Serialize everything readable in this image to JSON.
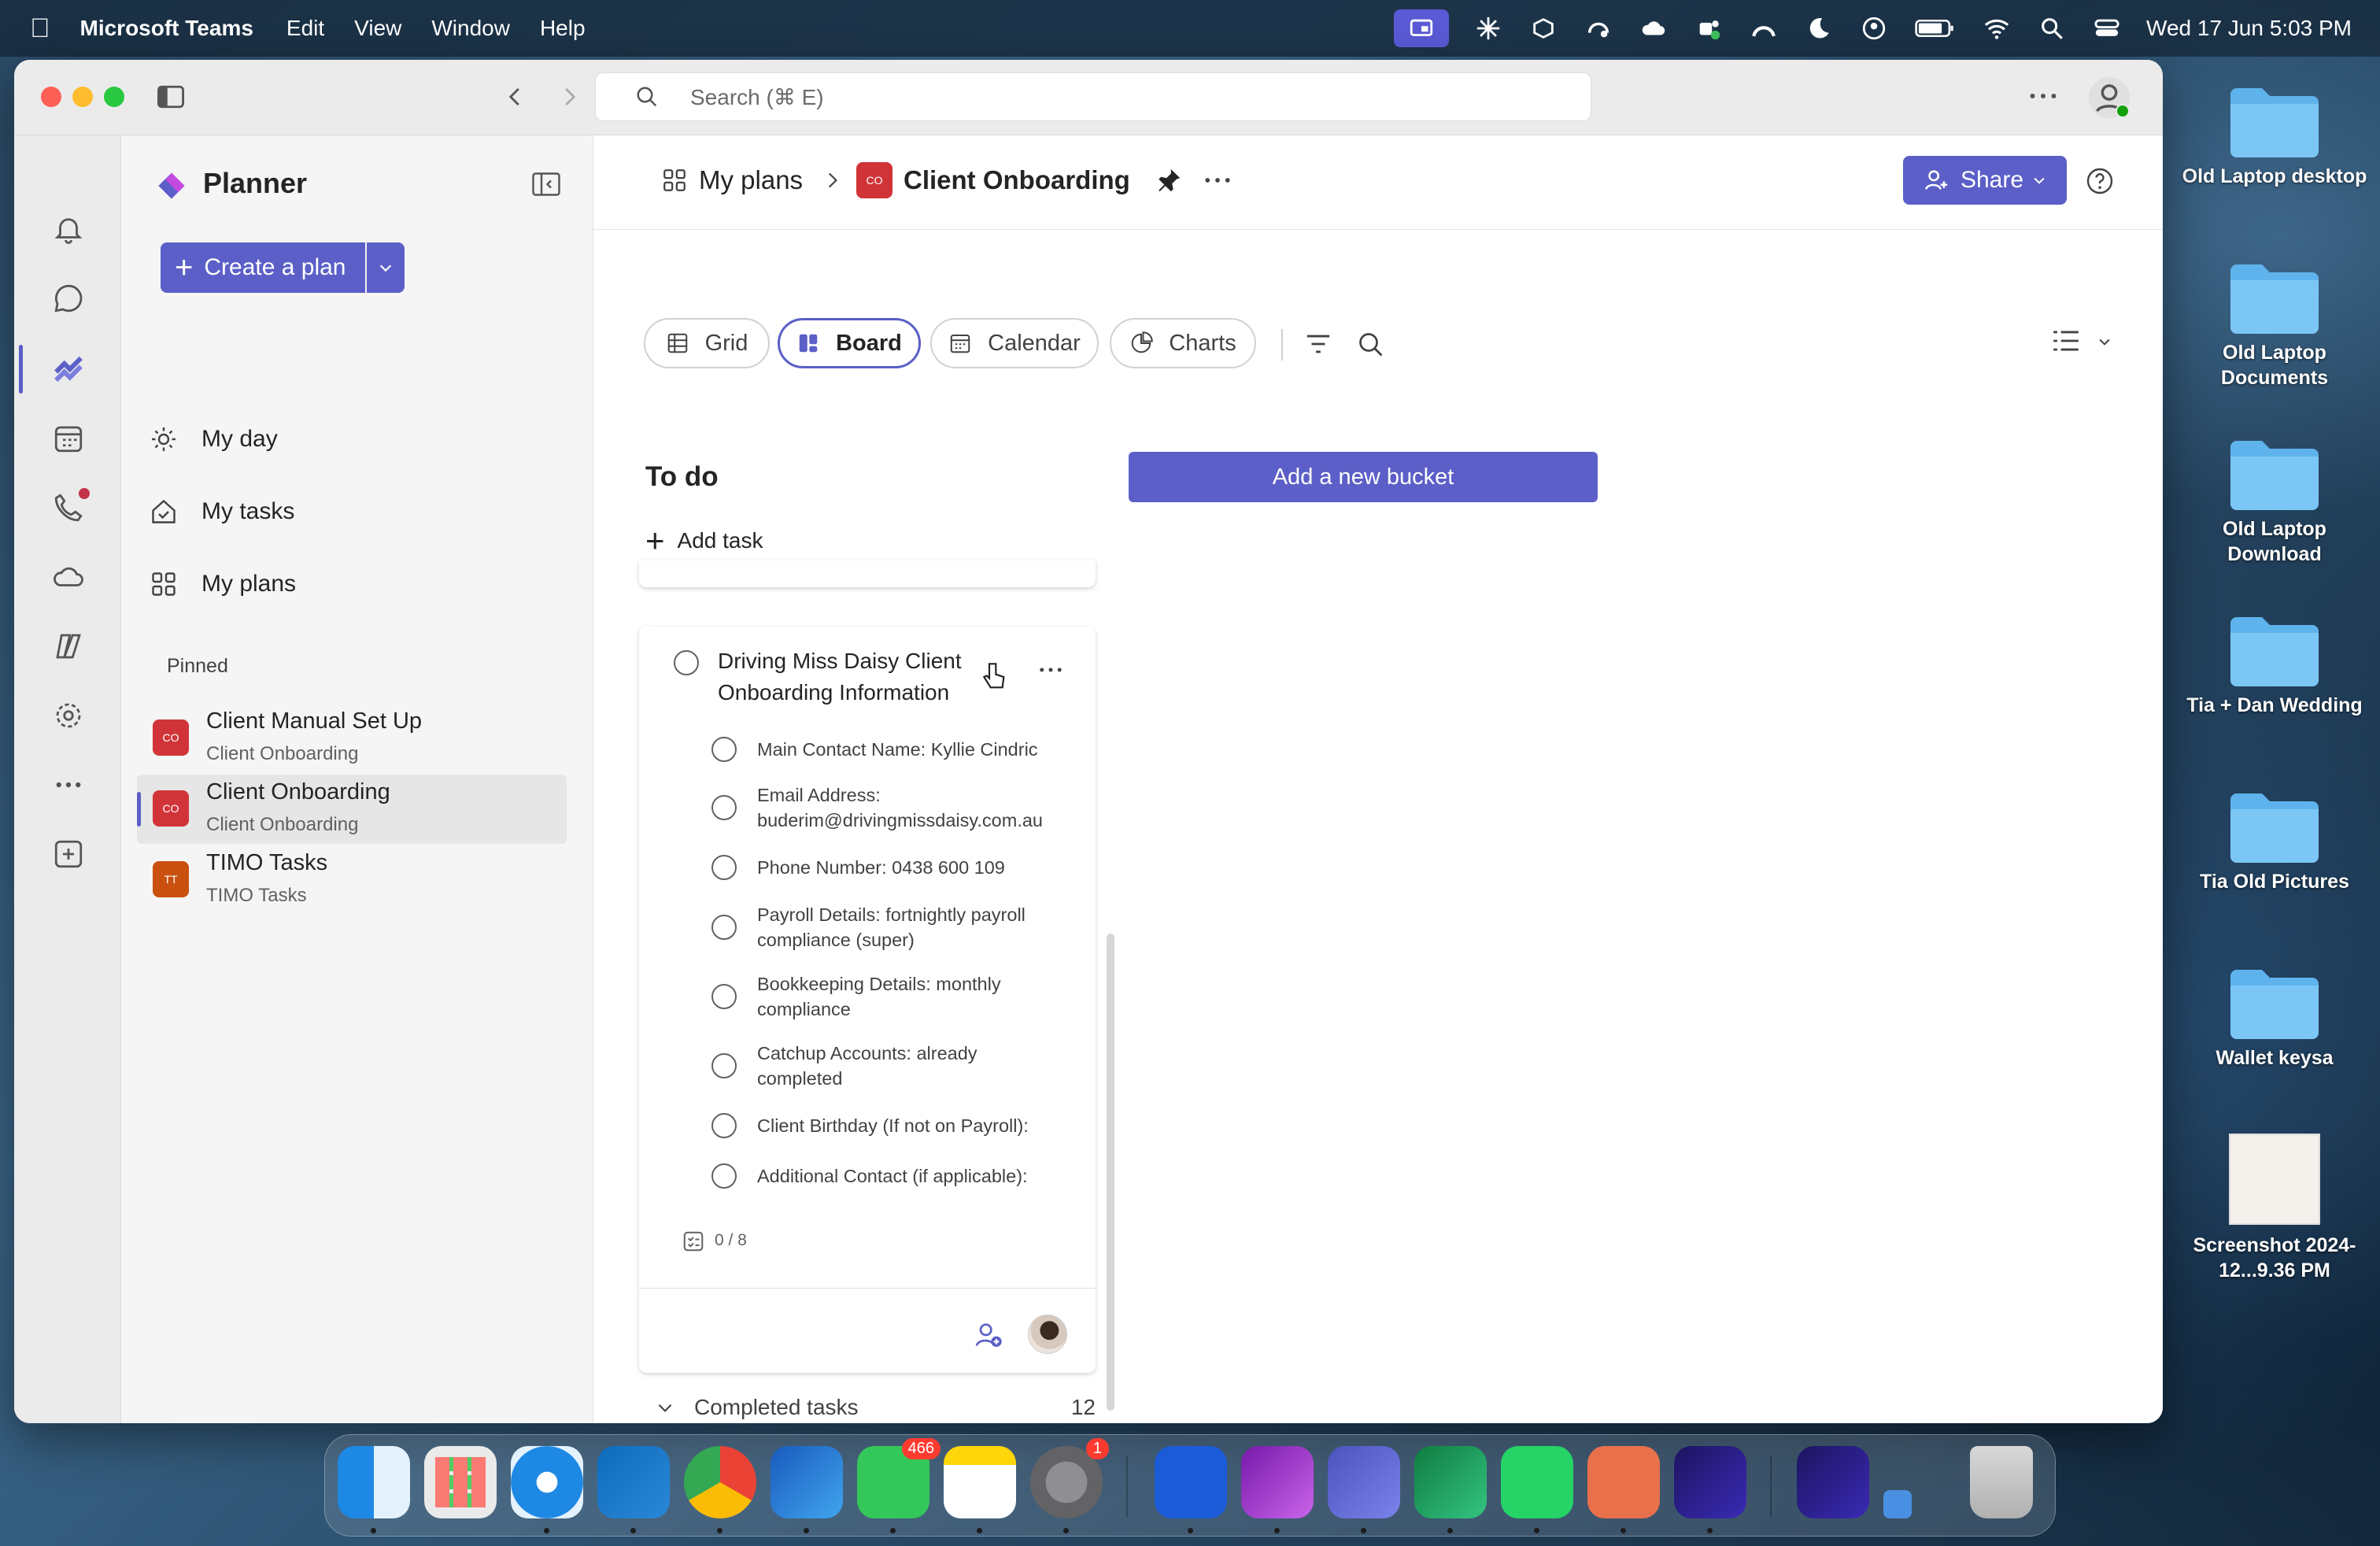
{
  "menubar": {
    "app_name": "Microsoft Teams",
    "menus": [
      "Edit",
      "View",
      "Window",
      "Help"
    ],
    "clock": "Wed 17 Jun  5:03 PM"
  },
  "window": {
    "search_placeholder": "Search (⌘ E)"
  },
  "sidebar": {
    "app_title": "Planner",
    "create_plan": "Create a plan",
    "nav": [
      {
        "label": "My day",
        "icon": "sun-icon"
      },
      {
        "label": "My tasks",
        "icon": "home-check-icon"
      },
      {
        "label": "My plans",
        "icon": "grid-icon"
      }
    ],
    "pinned_label": "Pinned",
    "pinned": [
      {
        "title": "Client Manual Set Up",
        "subtitle": "Client Onboarding",
        "badge": "CO",
        "color": "#d13438"
      },
      {
        "title": "Client Onboarding",
        "subtitle": "Client Onboarding",
        "badge": "CO",
        "color": "#d13438"
      },
      {
        "title": "TIMO Tasks",
        "subtitle": "TIMO Tasks",
        "badge": "TT",
        "color": "#ca5010"
      }
    ]
  },
  "header": {
    "breadcrumb_root": "My plans",
    "plan_badge": "CO",
    "plan_title": "Client Onboarding",
    "share": "Share"
  },
  "tabs": [
    {
      "label": "Grid",
      "active": false
    },
    {
      "label": "Board",
      "active": true
    },
    {
      "label": "Calendar",
      "active": false
    },
    {
      "label": "Charts",
      "active": false
    }
  ],
  "board": {
    "bucket_title": "To do",
    "add_task": "Add task",
    "add_bucket": "Add a new bucket",
    "task": {
      "title": "Driving Miss Daisy Client Onboarding Information",
      "checklist": [
        "Main Contact Name: Kyllie Cindric",
        "Email Address: buderim@drivingmissdaisy.com.au",
        "Phone Number: 0438 600 109",
        "Payroll Details: fortnightly payroll compliance (super)",
        "Bookkeeping Details: monthly compliance",
        "Catchup Accounts: already completed",
        "Client Birthday (If not on Payroll):",
        "Additional Contact (if applicable):"
      ],
      "progress": "0 / 8"
    },
    "completed_label": "Completed tasks",
    "completed_count": "12"
  },
  "desktop": {
    "icons": [
      "Old Laptop desktop",
      "Old Laptop Documents",
      "Old Laptop Download",
      "Tia + Dan Wedding",
      "Tia Old Pictures",
      "Wallet keysa",
      "Screenshot 2024-12...9.36 PM"
    ]
  },
  "dock": {
    "messages_badge": "466",
    "settings_badge": "1"
  },
  "colors": {
    "accent": "#5b5fc7",
    "plan_red": "#d13438",
    "timo_orange": "#ca5010"
  }
}
